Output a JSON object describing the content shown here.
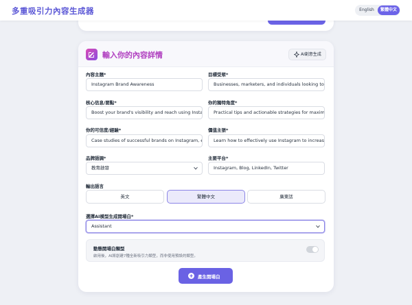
{
  "app": {
    "title": "多重吸引力內容生成器",
    "lang_en": "English",
    "lang_zh": "繁體中文"
  },
  "colors": {
    "accent": "#6a62e4",
    "title_gradient_start": "#d94ab5",
    "title_gradient_end": "#8b4de0"
  },
  "card": {
    "title": "輸入你的內容詳情",
    "ai_button": "AI創意生成",
    "fields": {
      "topic": {
        "label": "內容主題*",
        "value": "Instagram Brand Awareness"
      },
      "audience": {
        "label": "目標受眾*",
        "value": "Businesses, marketers, and individuals looking to grow"
      },
      "core": {
        "label": "核心信息/要點*",
        "value": "Boost your brand's visibility and reach using Instagram"
      },
      "angle": {
        "label": "你的獨特角度*",
        "value": "Practical tips and actionable strategies for maximizing"
      },
      "credibility": {
        "label": "你的可信度/經驗*",
        "value": "Case studies of successful brands on Instagram, expe"
      },
      "value_prop": {
        "label": "價值主張*",
        "value": "Learn how to effectively use Instagram to increase bra"
      },
      "tone": {
        "label": "品牌語調*",
        "value": "教育啟發"
      },
      "platforms": {
        "label": "主要平台*",
        "value": "Instagram, Blog, LinkedIn, Twitter"
      }
    },
    "output_language": {
      "label": "輸出語言",
      "options": [
        "英文",
        "繁體中文",
        "廣東話"
      ],
      "selected": "繁體中文"
    },
    "model": {
      "label": "選擇AI模型生成開場白*",
      "value": "Assistant"
    },
    "dynamic": {
      "title": "動態開場白類型",
      "description": "啟用後，AI將創建7種全新吸引力類型，而非使用預設的類型。",
      "enabled": false
    },
    "generate_button": "產生開場白"
  }
}
